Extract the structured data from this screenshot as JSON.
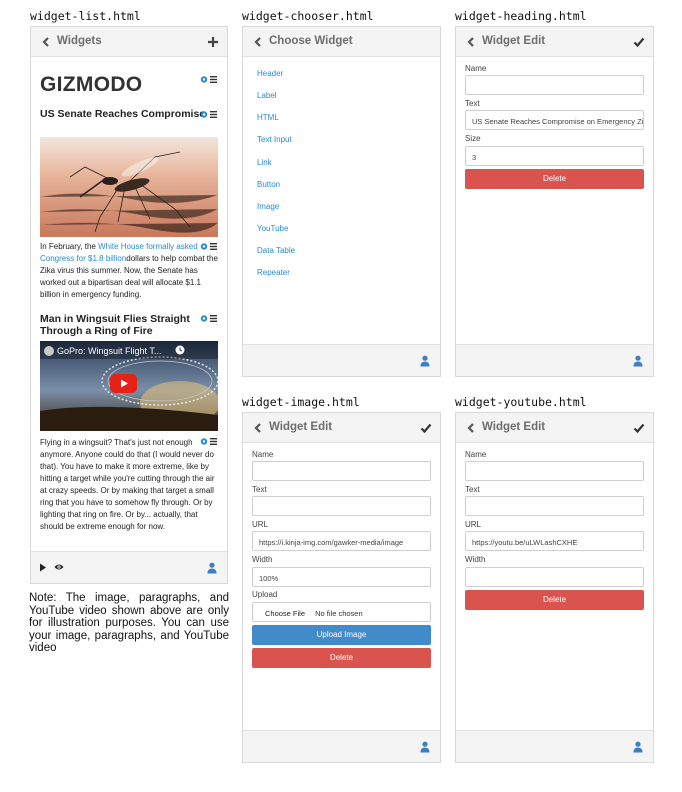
{
  "captions": {
    "list": "widget-list.html",
    "chooser": "widget-chooser.html",
    "heading": "widget-heading.html",
    "image": "widget-image.html",
    "youtube": "widget-youtube.html"
  },
  "widget_list": {
    "title": "Widgets",
    "brand": "GIZMODO",
    "heading1": "US Senate Reaches Compromise on Emergency Zika Funding",
    "paragraph1": {
      "before": "In February, the ",
      "link": "White House formally asked Congress for $1.8 billion",
      "after": "dollars to help combat the Zika virus this summer. Now, the Senate has worked out a bipartisan deal will allocate $1.1 billion in emergency funding."
    },
    "heading2": "Man in Wingsuit Flies Straight Through a Ring of Fire",
    "video_title": "GoPro: Wingsuit Flight T...",
    "paragraph2": "Flying in a wingsuit? That's just not enough anymore. Anyone could do that (I would never do that). You have to make it more extreme, like by hitting a target while you're cutting through the air at crazy speeds. Or by making that target a small ring that you have to somehow fly through. Or by lighting that ring on fire. Or by... actually, that should be extreme enough for now."
  },
  "widget_chooser": {
    "title": "Choose Widget",
    "items": [
      "Header",
      "Label",
      "HTML",
      "Text Input",
      "Link",
      "Button",
      "Image",
      "YouTube",
      "Data Table",
      "Repeater"
    ]
  },
  "widget_heading": {
    "title": "Widget Edit",
    "name_label": "Name",
    "name_value": "",
    "text_label": "Text",
    "text_value": "US Senate Reaches Compromise on Emergency Zika Funding",
    "size_label": "Size",
    "size_value": "3",
    "delete_label": "Delete"
  },
  "widget_image": {
    "title": "Widget Edit",
    "name_label": "Name",
    "text_label": "Text",
    "url_label": "URL",
    "url_value": "https://i.kinja-img.com/gawker-media/image",
    "width_label": "Width",
    "width_value": "100%",
    "upload_label": "Upload",
    "choose_file_label": "Choose File",
    "no_file_label": "No file chosen",
    "upload_button_label": "Upload Image",
    "delete_label": "Delete"
  },
  "widget_youtube": {
    "title": "Widget Edit",
    "name_label": "Name",
    "text_label": "Text",
    "url_label": "URL",
    "url_value": "https://youtu.be/uLWLashCXHE",
    "width_label": "Width",
    "delete_label": "Delete"
  },
  "note": "Note: The image, paragraphs, and YouTube video shown above are only for illustration purposes. You can use your image, paragraphs, and YouTube video",
  "colors": {
    "topbar": "#f4f4f4",
    "link": "#2a8bd0",
    "danger": "#d9534f",
    "primary": "#428bca",
    "youtube_red": "#e62117"
  }
}
